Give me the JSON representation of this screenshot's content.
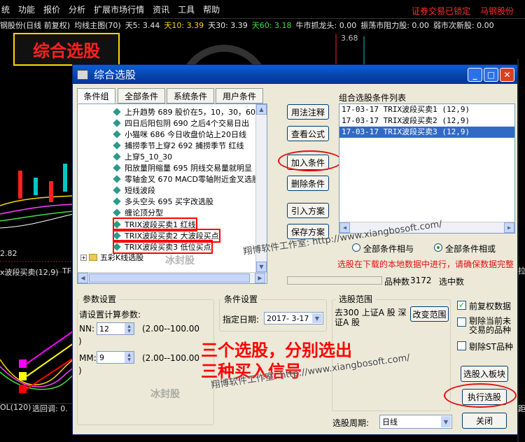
{
  "menu": {
    "items": [
      "统",
      "功能",
      "报价",
      "分析",
      "扩展市场行情",
      "资讯",
      "工具",
      "帮助"
    ],
    "right_notice": "证券交易已锁定",
    "right_stock": "马钢股份"
  },
  "infobar": {
    "stock": "钢股份(日线 前复权)",
    "indicator": "均线主图(70)",
    "ma5": "天5: 3.44",
    "ma10": "天10: 3.39",
    "ma30": "天30: 3.39",
    "ma60": "天60: 3.18",
    "item1": "牛市抓龙头: 0.00",
    "item2": "振荡市阻力股: 0.00",
    "item3": "弱市次新股: 0.00"
  },
  "chart": {
    "price_label": "3.68",
    "low_label": "2.82",
    "sub_label": "x波段买卖(12,9)",
    "sub_label2": "TF",
    "bottom_label": "OL(120)",
    "bottom_label2": "选回调: 0.",
    "right_fragment1": "拉",
    "right_fragment2": "距"
  },
  "banner": {
    "text": "综合选股"
  },
  "dialog": {
    "title": "综合选股",
    "tabs": [
      "条件组",
      "全部条件",
      "系统条件",
      "用户条件"
    ],
    "tree_items": [
      {
        "text": "上升趋势 689  股价在5，10，30，60"
      },
      {
        "text": "四日后阳包阴 690 之后4个交易日出"
      },
      {
        "text": "小猫咪 686 今日收盘价站上20日线"
      },
      {
        "text": "捕捞季节上穿2 692 捕捞季节 红线"
      },
      {
        "text": "上穿5_10_30"
      },
      {
        "text": "阳放量阴缩量 695 阴线交易量就明显"
      },
      {
        "text": "零轴金叉 670 MACD零轴附近金叉选股"
      },
      {
        "text": "短线波段"
      },
      {
        "text": "多头空头 695 买字改选股"
      },
      {
        "text": "缠论顶分型"
      },
      {
        "text": "TRIX波段买卖1 红线"
      },
      {
        "text": "TRIX波段买卖2 大波段买点"
      },
      {
        "text": "TRIX波段买卖3 低位买点"
      },
      {
        "text": "五彩K线选股"
      }
    ],
    "mid_buttons": [
      "用法注释",
      "查看公式",
      "加入条件",
      "删除条件",
      "引入方案",
      "保存方案"
    ],
    "list_title": "组合选股条件列表",
    "list_items": [
      "17-03-17 TRIX波段买卖1 (12,9)",
      "17-03-17 TRIX波段买卖2 (12,9)",
      "17-03-17 TRIX波段买卖3 (12,9)"
    ],
    "radio_and": "全部条件相与",
    "radio_or": "全部条件相或",
    "notice": "选股在下载的本地数据中进行，请确保数据完整",
    "count_label": "品种数",
    "count_value": "3172",
    "selected_label": "选中数",
    "params": {
      "title": "参数设置",
      "hint": "请设置计算参数:",
      "nn_label": "NN:",
      "nn_value": "12",
      "nn_range": "(2.00--100.00",
      "nn_close": ")",
      "mm_label": "MM:",
      "mm_value": "9",
      "mm_range": "(2.00--100.00",
      "mm_close": ")"
    },
    "condition": {
      "title": "条件设置",
      "date_label": "指定日期:",
      "date_value": "2017- 3-17"
    },
    "range": {
      "title": "选股范围",
      "text": "去300 上证A 股 深证A 股",
      "change_button": "改变范围"
    },
    "options": {
      "fq": "前复权数据",
      "exclude_halt": "剔除当前未交易的品种",
      "exclude_st": "剔除ST品种"
    },
    "buttons": {
      "to_block": "选股入板块",
      "execute": "执行选股",
      "close": "关闭"
    },
    "period_label": "选股周期:",
    "period_value": "日线"
  },
  "annotations": {
    "line1": "三个选股，分别选出",
    "line2": "三种买入信号"
  },
  "watermarks": {
    "url1": "翔博软件工作室: http://www.xiangbosoft.com/",
    "url2": "翔博软件工作室: http://www.xiangbosoft.com/",
    "ice1": "冰封股",
    "ice2": "冰封股"
  },
  "colors": {
    "accent_red": "#ff0000",
    "title_blue": "#0842a8",
    "select_blue": "#316ac5"
  }
}
